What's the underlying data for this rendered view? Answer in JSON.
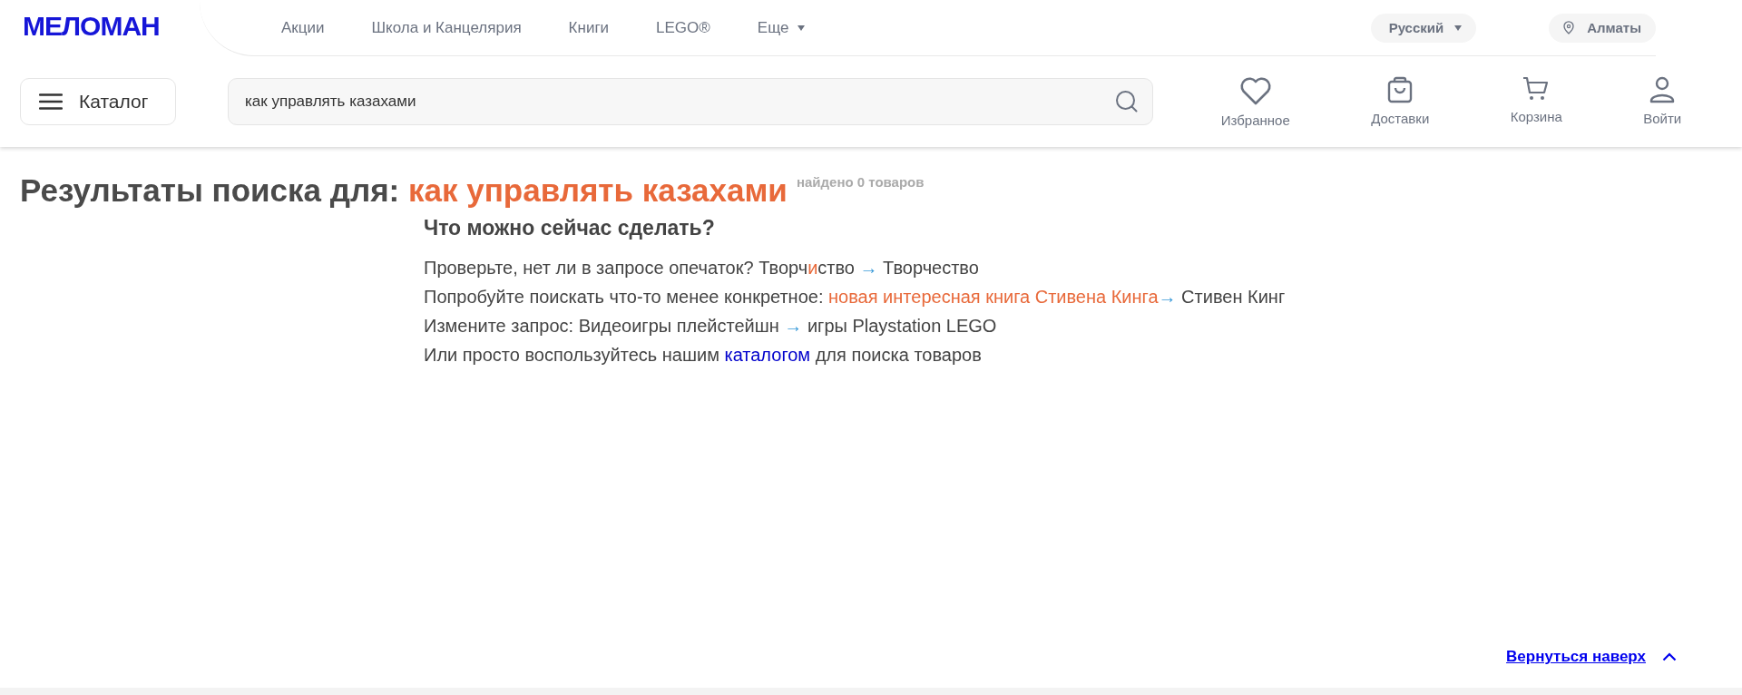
{
  "logo": "МЕЛОМАН",
  "nav": [
    {
      "label": "Акции",
      "kind": "link"
    },
    {
      "label": "Школа и Канцелярия",
      "kind": "link"
    },
    {
      "label": "Книги",
      "kind": "link"
    },
    {
      "label": "LEGO®",
      "kind": "link"
    },
    {
      "label": "Еще",
      "kind": "dropdown"
    }
  ],
  "language": {
    "label": "Русский"
  },
  "city": {
    "label": "Алматы"
  },
  "catalog_button": {
    "label": "Каталог"
  },
  "search": {
    "value": "как управлять казахами"
  },
  "actions": [
    {
      "label": "Избранное",
      "kind": "heart"
    },
    {
      "label": "Доставки",
      "kind": "bag"
    },
    {
      "label": "Корзина",
      "kind": "cart"
    },
    {
      "label": "Войти",
      "kind": "user"
    }
  ],
  "results": {
    "prefix": "Результаты поиска для:",
    "query": "как управлять казахами",
    "count": "найдено 0 товаров"
  },
  "help": {
    "title": "Что можно сейчас сделать?",
    "lines": [
      [
        {
          "text": "Проверьте, нет ли в запросе опечаток? Творч",
          "kind": "plain"
        },
        {
          "text": "и",
          "kind": "highlight"
        },
        {
          "text": "ство ",
          "kind": "plain"
        },
        {
          "text": "→",
          "kind": "arrow"
        },
        {
          "text": " Творчество",
          "kind": "plain"
        }
      ],
      [
        {
          "text": "Попробуйте поискать что-то менее конкретное: ",
          "kind": "plain"
        },
        {
          "text": "новая интересная книга Стивена Кинга",
          "kind": "highlight"
        },
        {
          "text": "→",
          "kind": "arrow"
        },
        {
          "text": " Стивен Кинг",
          "kind": "plain"
        }
      ],
      [
        {
          "text": "Измените запрос: Видеоигры плейстейшн ",
          "kind": "plain"
        },
        {
          "text": "→",
          "kind": "arrow"
        },
        {
          "text": " игры Playstation LEGO",
          "kind": "plain"
        }
      ],
      [
        {
          "text": "Или просто воспользуйтесь нашим ",
          "kind": "plain"
        },
        {
          "text": "каталогом",
          "kind": "link"
        },
        {
          "text": " для поиска товаров",
          "kind": "plain"
        }
      ]
    ]
  },
  "back_to_top": {
    "label": "Вернуться наверх"
  }
}
